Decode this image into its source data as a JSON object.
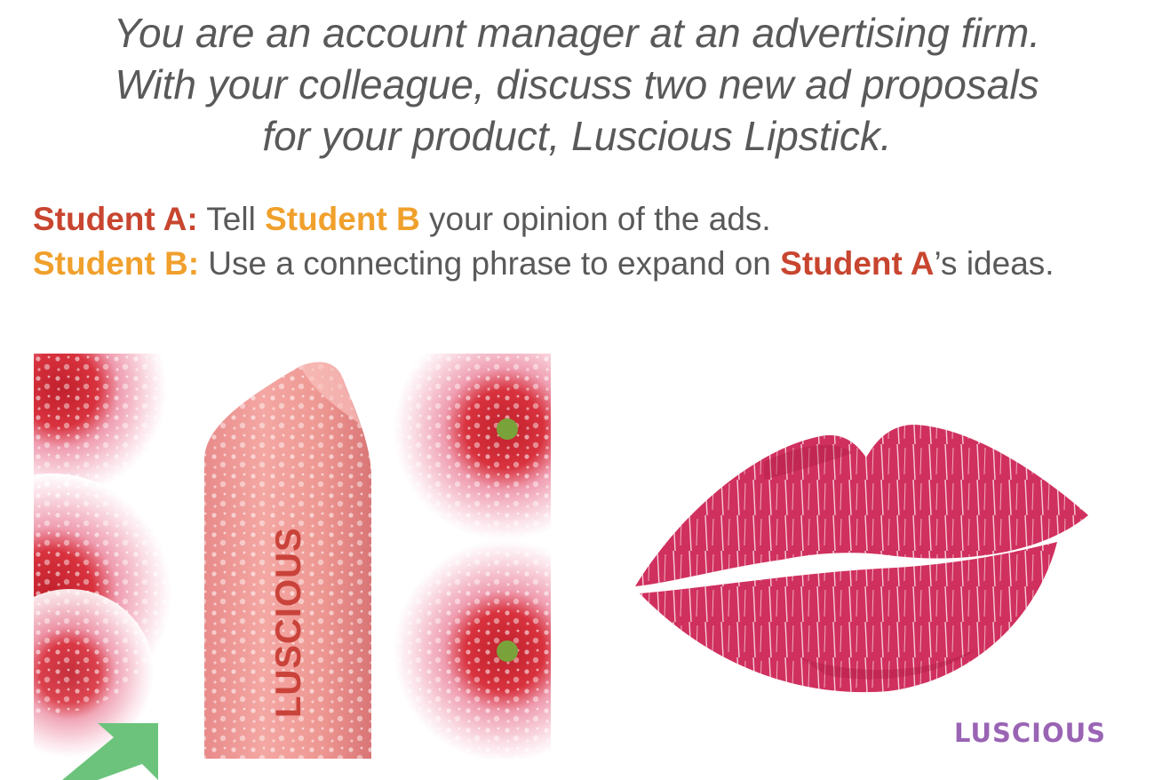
{
  "title": {
    "line1": "You are an account manager at an advertising firm.",
    "line2": "With your colleague, discuss two new ad proposals",
    "line3": "for your product, Luscious Lipstick."
  },
  "instructions": {
    "a_label": "Student A:",
    "a_text1": " Tell ",
    "a_ref_b": "Student B",
    "a_text2": " your opinion of the ads.",
    "b_label": "Student B:",
    "b_text1": " Use a connecting phrase to expand on ",
    "b_ref_a": "Student A",
    "b_text2": "’s ideas."
  },
  "ad1": {
    "brand": "LUSCIOUS"
  },
  "ad2": {
    "brand": "LUSCIOUS"
  },
  "colors": {
    "student_a": "#c8452f",
    "student_b": "#f0a02c",
    "body_text": "#595959",
    "brand_purple": "#9a64b4",
    "lip_pink": "#d0305e",
    "arrow_green": "#6cc47c"
  }
}
